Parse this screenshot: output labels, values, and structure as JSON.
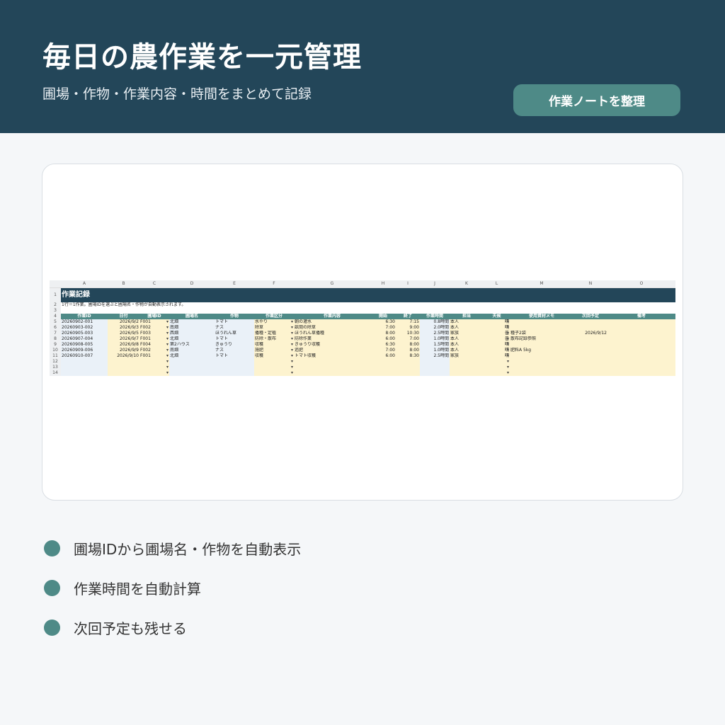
{
  "hero": {
    "title": "毎日の農作業を一元管理",
    "subtitle": "圃場・作物・作業内容・時間をまとめて記録",
    "button_label": "作業ノートを整理"
  },
  "sheet": {
    "column_letters": [
      "A",
      "B",
      "C",
      "D",
      "E",
      "F",
      "G",
      "H",
      "I",
      "J",
      "K",
      "L",
      "M",
      "N",
      "O"
    ],
    "row_numbers": [
      "1",
      "2",
      "3",
      "4",
      "5",
      "6",
      "7",
      "8",
      "9",
      "10",
      "11",
      "12",
      "13",
      "14"
    ],
    "title": "作業記録",
    "note": "1行＝1作業。圃場IDを選ぶと圃場名・作物が自動表示されます。",
    "headers": [
      "作業ID",
      "日付",
      "圃場ID",
      "圃場名",
      "作物",
      "作業区分",
      "作業内容",
      "開始",
      "終了",
      "作業時間",
      "担当",
      "天候",
      "使用資材メモ",
      "次回予定",
      "備考"
    ],
    "dropdown_glyph": "▾",
    "rows": [
      {
        "id": "20260902-001",
        "date": "2026/9/2",
        "field_id": "F001",
        "field_name": "北畑",
        "crop": "トマト",
        "category": "水やり",
        "content": "朝の灌水",
        "start": "6:30",
        "end": "7:15",
        "hours": "0.8時間",
        "staff": "本人",
        "weather": "晴",
        "memo": "",
        "next": "",
        "remark": ""
      },
      {
        "id": "20260903-002",
        "date": "2026/9/3",
        "field_id": "F002",
        "field_name": "南畑",
        "crop": "ナス",
        "category": "除草",
        "content": "畝間の除草",
        "start": "7:00",
        "end": "9:00",
        "hours": "2.0時間",
        "staff": "本人",
        "weather": "晴",
        "memo": "",
        "next": "",
        "remark": ""
      },
      {
        "id": "20260905-003",
        "date": "2026/9/5",
        "field_id": "F003",
        "field_name": "西畑",
        "crop": "ほうれん草",
        "category": "播種・定植",
        "content": "ほうれん草播種",
        "start": "8:00",
        "end": "10:30",
        "hours": "2.5時間",
        "staff": "家族",
        "weather": "曇",
        "memo": "種子2袋",
        "next": "2026/9/12",
        "remark": ""
      },
      {
        "id": "20260907-004",
        "date": "2026/9/7",
        "field_id": "F001",
        "field_name": "北畑",
        "crop": "トマト",
        "category": "防除・散布",
        "content": "防除作業",
        "start": "6:00",
        "end": "7:00",
        "hours": "1.0時間",
        "staff": "本人",
        "weather": "曇",
        "memo": "散布記録参照",
        "next": "",
        "remark": ""
      },
      {
        "id": "20260908-005",
        "date": "2026/9/8",
        "field_id": "F004",
        "field_name": "第2ハウス",
        "crop": "きゅうり",
        "category": "収穫",
        "content": "きゅうり収穫",
        "start": "6:30",
        "end": "8:00",
        "hours": "1.5時間",
        "staff": "本人",
        "weather": "晴",
        "memo": "",
        "next": "",
        "remark": ""
      },
      {
        "id": "20260909-006",
        "date": "2026/9/9",
        "field_id": "F002",
        "field_name": "南畑",
        "crop": "ナス",
        "category": "施肥",
        "content": "追肥",
        "start": "7:00",
        "end": "8:00",
        "hours": "1.0時間",
        "staff": "本人",
        "weather": "晴",
        "memo": "肥料A 5kg",
        "next": "",
        "remark": ""
      },
      {
        "id": "20260910-007",
        "date": "2026/9/10",
        "field_id": "F001",
        "field_name": "北畑",
        "crop": "トマト",
        "category": "収穫",
        "content": "トマト収穫",
        "start": "6:00",
        "end": "8:30",
        "hours": "2.5時間",
        "staff": "家族",
        "weather": "晴",
        "memo": "",
        "next": "",
        "remark": ""
      }
    ]
  },
  "features": [
    {
      "label": "圃場IDから圃場名・作物を自動表示"
    },
    {
      "label": "作業時間を自動計算"
    },
    {
      "label": "次回予定も残せる"
    }
  ],
  "colors": {
    "header_bg": "#234659",
    "accent": "#4e8a87",
    "input_yellow": "#fdf3cf",
    "auto_blue": "#eaf1f8"
  }
}
